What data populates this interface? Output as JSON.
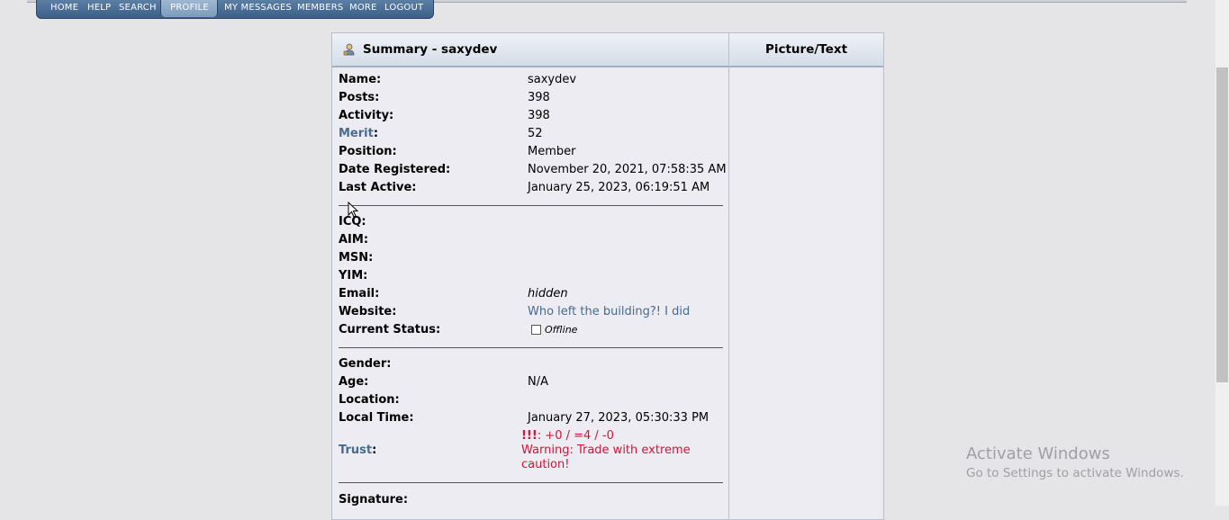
{
  "nav": {
    "items": [
      "HOME",
      "HELP",
      "SEARCH",
      "PROFILE",
      "MY MESSAGES",
      "MEMBERS",
      "MORE",
      "LOGOUT"
    ],
    "active": "PROFILE"
  },
  "header": {
    "title": "Summary - saxydev",
    "right_title": "Picture/Text"
  },
  "profile": {
    "name_label": "Name:",
    "name": "saxydev",
    "posts_label": "Posts:",
    "posts": "398",
    "activity_label": "Activity:",
    "activity": "398",
    "merit_label": "Merit",
    "merit_colon": ":",
    "merit": "52",
    "position_label": "Position:",
    "position": "Member",
    "registered_label": "Date Registered:",
    "registered": "November 20, 2021, 07:58:35 AM",
    "last_active_label": "Last Active:",
    "last_active": "January 25, 2023, 06:19:51 AM",
    "icq_label": "ICQ:",
    "aim_label": "AIM:",
    "msn_label": "MSN:",
    "yim_label": "YIM:",
    "email_label": "Email:",
    "email": "hidden",
    "website_label": "Website:",
    "website": "Who left the building?! I did",
    "status_label": "Current Status:",
    "status": "Offline",
    "gender_label": "Gender:",
    "age_label": "Age:",
    "age": "N/A",
    "location_label": "Location:",
    "local_time_label": "Local Time:",
    "local_time": "January 27, 2023, 05:30:33 PM",
    "trust_label": "Trust",
    "trust_colon": ":",
    "trust_score_bang": "!!!",
    "trust_score_rest": ": +0 / =4 / -0",
    "trust_warning_1": "Warning: Trade with extreme",
    "trust_warning_2": "caution!",
    "signature_label": "Signature:"
  },
  "watermark": {
    "line1": "Activate Windows",
    "line2": "Go to Settings to activate Windows."
  },
  "colors": {
    "link": "#476c8e",
    "warning": "#d0173b",
    "nav_bg": "#3b5f88"
  }
}
